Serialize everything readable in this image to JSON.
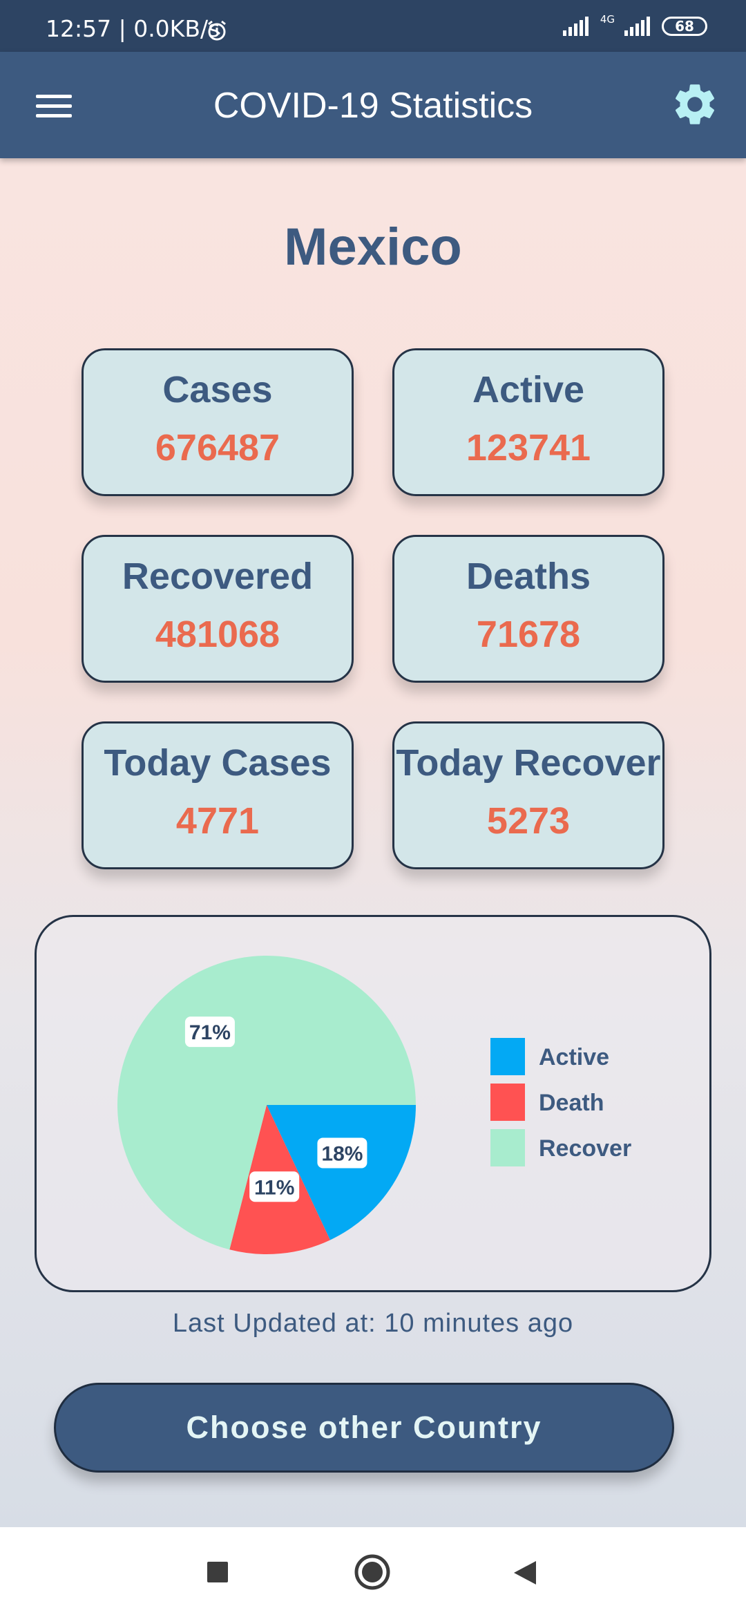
{
  "status_bar": {
    "time_speed": "12:57 | 0.0KB/s",
    "network_label": "4G",
    "battery": "68"
  },
  "app_bar": {
    "title": "COVID-19 Statistics",
    "menu_icon": "hamburger-menu-icon",
    "settings_icon": "gear-icon"
  },
  "country": "Mexico",
  "stats": [
    {
      "label": "Cases",
      "value": "676487"
    },
    {
      "label": "Active",
      "value": "123741"
    },
    {
      "label": "Recovered",
      "value": "481068"
    },
    {
      "label": "Deaths",
      "value": "71678"
    },
    {
      "label": "Today Cases",
      "value": "4771"
    },
    {
      "label": "Today Recover",
      "value": "5273"
    }
  ],
  "chart_data": {
    "type": "pie",
    "labels": [
      "Active",
      "Death",
      "Recover"
    ],
    "values": [
      18,
      11,
      71
    ],
    "value_labels": [
      "18%",
      "11%",
      "71%"
    ],
    "colors": [
      "#03a9f4",
      "#ff5252",
      "#a8ecce"
    ],
    "legend_placement": "right"
  },
  "last_updated": "Last Updated at: 10 minutes ago",
  "choose_button": "Choose other Country",
  "colors": {
    "app_bar": "#3d5a80",
    "status_bar": "#2d4463",
    "card_bg": "#d3e6e9",
    "value_text": "#ea6a4e",
    "label_text": "#3d5a80"
  },
  "nav": {
    "recents_icon": "square-recents-icon",
    "home_icon": "circle-home-icon",
    "back_icon": "triangle-back-icon"
  }
}
